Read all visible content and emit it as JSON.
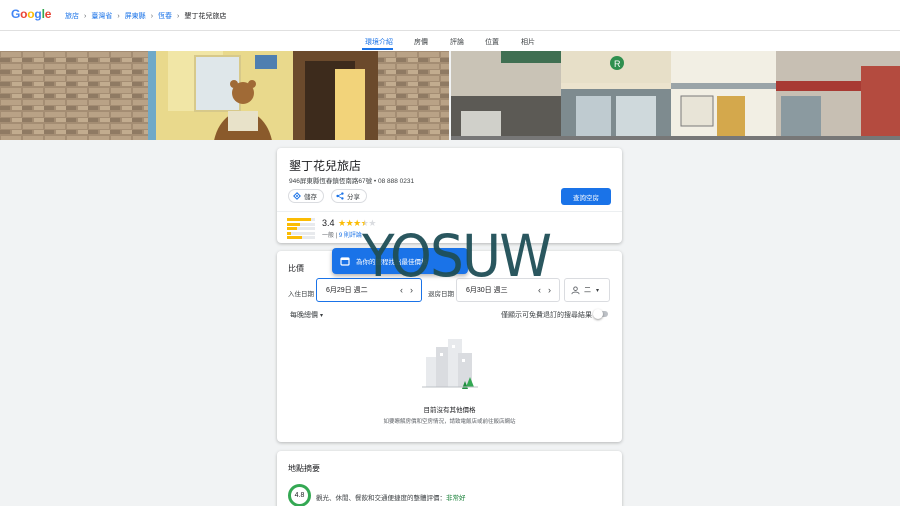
{
  "header": {
    "logo": "Google",
    "logo_colors": [
      "#4285F4",
      "#EA4335",
      "#FBBC05",
      "#4285F4",
      "#34A853",
      "#EA4335"
    ],
    "breadcrumbs": [
      "旅店",
      "臺灣省",
      "屏東縣",
      "恆春",
      "墾丁花兒旅店"
    ]
  },
  "tabs": [
    {
      "label": "環境介紹",
      "active": true
    },
    {
      "label": "房價",
      "active": false
    },
    {
      "label": "評論",
      "active": false
    },
    {
      "label": "位置",
      "active": false
    },
    {
      "label": "相片",
      "active": false
    }
  ],
  "hotel": {
    "name": "墾丁花兒旅店",
    "address_phone": "946屏東縣恆春鎮恆南路67號 • 08 888 0231",
    "save_label": "儲存",
    "share_label": "分享",
    "check_label": "查詢空房",
    "rating": "3.4",
    "rating_stars": 3.4,
    "rating_word": "一般",
    "review_count": "9 則評論",
    "rating_distribution": [
      0.85,
      0.45,
      0.35,
      0.15,
      0.55
    ]
  },
  "prices": {
    "section_title": "比價",
    "banner_text": "為你的旅程找出最佳價格",
    "checkin_label": "入住日期",
    "checkin_value": "6月29日 週二",
    "checkout_label": "退房日期",
    "checkout_value": "6月30日 週三",
    "guests_value": "二",
    "price_selector": "每晚總價",
    "toggle_label": "僅顯示可免費退訂的搜尋結果",
    "empty_title": "目前沒有其他價格",
    "empty_subtitle": "如要瞭解房價和空房情況，請致電飯店或前往飯店網站"
  },
  "location": {
    "section_title": "地點摘要",
    "score": "4.8",
    "summary_prefix": "觀光、休閒、餐飲和交通便捷度的整體評價：",
    "summary_highlight": "非常好"
  },
  "watermark": "YOSUW",
  "colors": {
    "accent": "#1a73e8",
    "star": "#fbbc04",
    "good": "#34a853"
  }
}
